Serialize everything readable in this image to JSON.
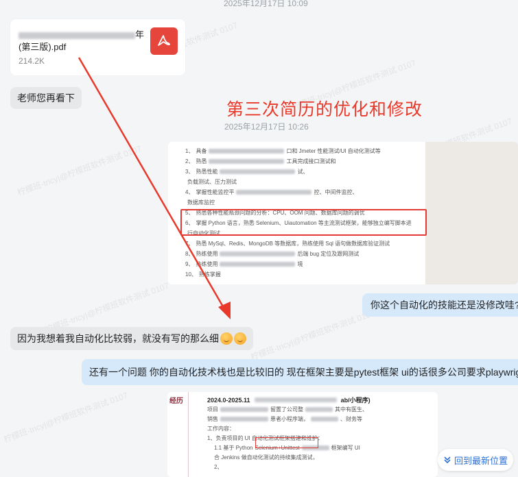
{
  "timestamps": {
    "top": "2025年12月17日 10:09",
    "second": "2025年12月17日 10:26"
  },
  "file": {
    "name_suffix_1": "年",
    "name_line_2": "(第三版).pdf",
    "size": "214.2K",
    "icon": "pdf-icon"
  },
  "messages": {
    "teacher_review": "老师您再看下",
    "annotation_title": "第三次简历的优化和修改",
    "question_auto": "你这个自动化的技能还是没修改哇?",
    "reply_weak": "因为我想着我自动化比较弱，就没有写的那么细",
    "issue_stack": "还有一个问题 你的自动化技术栈也是比较旧的  现在框架主要是pytest框架  ui的话很多公司要求playwright"
  },
  "resume_image_1": {
    "lines": [
      {
        "n": "1、",
        "pre": "具备",
        "post": "口和 Jmeter 性能测试/UI 自动化测试等"
      },
      {
        "n": "2、",
        "pre": "熟悉",
        "post": "工具完成接口测试和"
      },
      {
        "n": "3、",
        "pre": "熟悉性能",
        "post": "试、"
      },
      {
        "n": "",
        "pre": "负载测试、压力测试",
        "post": ""
      },
      {
        "n": "4、",
        "pre": "掌握性能监控平",
        "post": "控、中间件监控、"
      },
      {
        "n": "",
        "pre": "数据库监控",
        "post": ""
      },
      {
        "n": "5、",
        "pre": "熟悉各种性能瓶颈问题的分析：CPU、OOM 问题、数据库问题的调优",
        "post": ""
      },
      {
        "n": "6、",
        "pre": "掌握 Python 语言，熟悉 Selenium、Uiautomation 等主流测试框架，能够独立编写脚本进",
        "post": ""
      },
      {
        "n": "",
        "pre": "行自动化测试",
        "post": ""
      },
      {
        "n": "7、",
        "pre": "熟悉 MySql、Redis、MongoDB 等数据库，熟练使用 Sql 语句做数据库验证测试",
        "post": ""
      },
      {
        "n": "8、",
        "pre": "熟练使用",
        "post": "后端 bug 定位及跟网测试"
      },
      {
        "n": "9、",
        "pre": "熟练使用",
        "post": "境"
      },
      {
        "n": "10、",
        "pre": "熟练掌握",
        "post": ""
      }
    ]
  },
  "resume_image_2": {
    "section": "经历",
    "date": "2024.0-2025.11",
    "project_suffix": "ab/小程序)",
    "lines": [
      {
        "pre": "项目",
        "post": "留置了公司整",
        "tail": "其中有医生、"
      },
      {
        "pre": "销售",
        "post": "患者小程序端，",
        "tail": "、财务等"
      },
      {
        "pre": "工作内容：",
        "post": "",
        "tail": ""
      },
      {
        "pre": "1、负责项目的 UI 自动化测试框架搭建和维护：",
        "post": "",
        "tail": ""
      },
      {
        "pre": "1.1  基于 Python",
        "post": "Selenium+Unittest",
        "tail": "框架编写 UI"
      },
      {
        "pre": "合 Jenkins 做自动化测试的持续集成测试，",
        "post": "",
        "tail": ""
      },
      {
        "pre": "2、",
        "post": "",
        "tail": ""
      }
    ]
  },
  "back_button": {
    "label": "回到最新位置",
    "icon": "double-chevron-down-icon"
  },
  "watermark": {
    "text": "柠檬班-tricy|@柠檬班软件测试 0107"
  },
  "colors": {
    "annotation_red": "#e8392b",
    "accent_blue": "#2b6fd6",
    "bubble_right": "#d6e9fb",
    "bubble_left": "#e7e8ea"
  }
}
